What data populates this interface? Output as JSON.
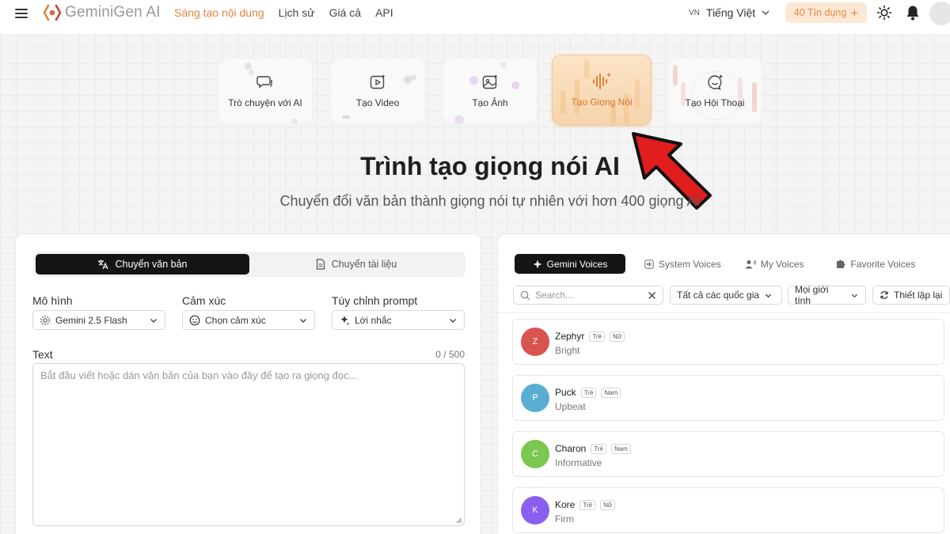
{
  "nav": {
    "brand": "GeminiGen AI",
    "links": [
      "Sáng tạo nội dung",
      "Lịch sử",
      "Giá cả",
      "API"
    ],
    "lang_code": "VN",
    "lang_label": "Tiếng Việt",
    "credits": "40 Tín dụng",
    "credits_plus": "+"
  },
  "tools": [
    {
      "label": "Trò chuyện với AI",
      "icon": "chat-icon"
    },
    {
      "label": "Tạo Video",
      "icon": "video-icon"
    },
    {
      "label": "Tạo Ảnh",
      "icon": "image-icon"
    },
    {
      "label": "Tạo Giọng Nói",
      "icon": "audio-wave-icon",
      "active": true
    },
    {
      "label": "Tạo Hội Thoại",
      "icon": "conversation-icon"
    }
  ],
  "hero": {
    "title": "Trình tạo giọng nói AI",
    "subtitle": "Chuyển đổi văn bản thành giọng nói tự nhiên với hơn 400 giọng AI"
  },
  "left": {
    "tabs": [
      "Chuyển văn bản",
      "Chuyển tài liệu"
    ],
    "model_label": "Mô hình",
    "model_value": "Gemini 2.5 Flash",
    "emotion_label": "Cảm xúc",
    "emotion_value": "Chọn cảm xúc",
    "prompt_label": "Tùy chỉnh prompt",
    "prompt_value": "Lời nhắc",
    "text_label": "Text",
    "counter": "0 / 500",
    "placeholder": "Bắt đầu viết hoặc dán văn bản của bạn vào đây để tạo ra giọng đọc..."
  },
  "right": {
    "tabs": [
      "Gemini Voices",
      "System Voices",
      "My Voices",
      "Favorite Voices"
    ],
    "search_placeholder": "Search...",
    "filter_country": "Tất cả các quốc gia",
    "filter_gender": "Mọi giới tính",
    "reset": "Thiết lập lại",
    "voices": [
      {
        "initial": "Z",
        "name": "Zephyr",
        "age": "Trẻ",
        "gender": "Nữ",
        "desc": "Bright",
        "color": "#d9534f"
      },
      {
        "initial": "P",
        "name": "Puck",
        "age": "Trẻ",
        "gender": "Nam",
        "desc": "Upbeat",
        "color": "#5aaed4"
      },
      {
        "initial": "C",
        "name": "Charon",
        "age": "Trẻ",
        "gender": "Nam",
        "desc": "Informative",
        "color": "#7cc652"
      },
      {
        "initial": "K",
        "name": "Kore",
        "age": "Trẻ",
        "gender": "Nữ",
        "desc": "Firm",
        "color": "#8a5ff0"
      }
    ]
  },
  "colors": {
    "accent": "#e3853a",
    "active_tab": "#151515",
    "arrow": "#e11d1d"
  }
}
